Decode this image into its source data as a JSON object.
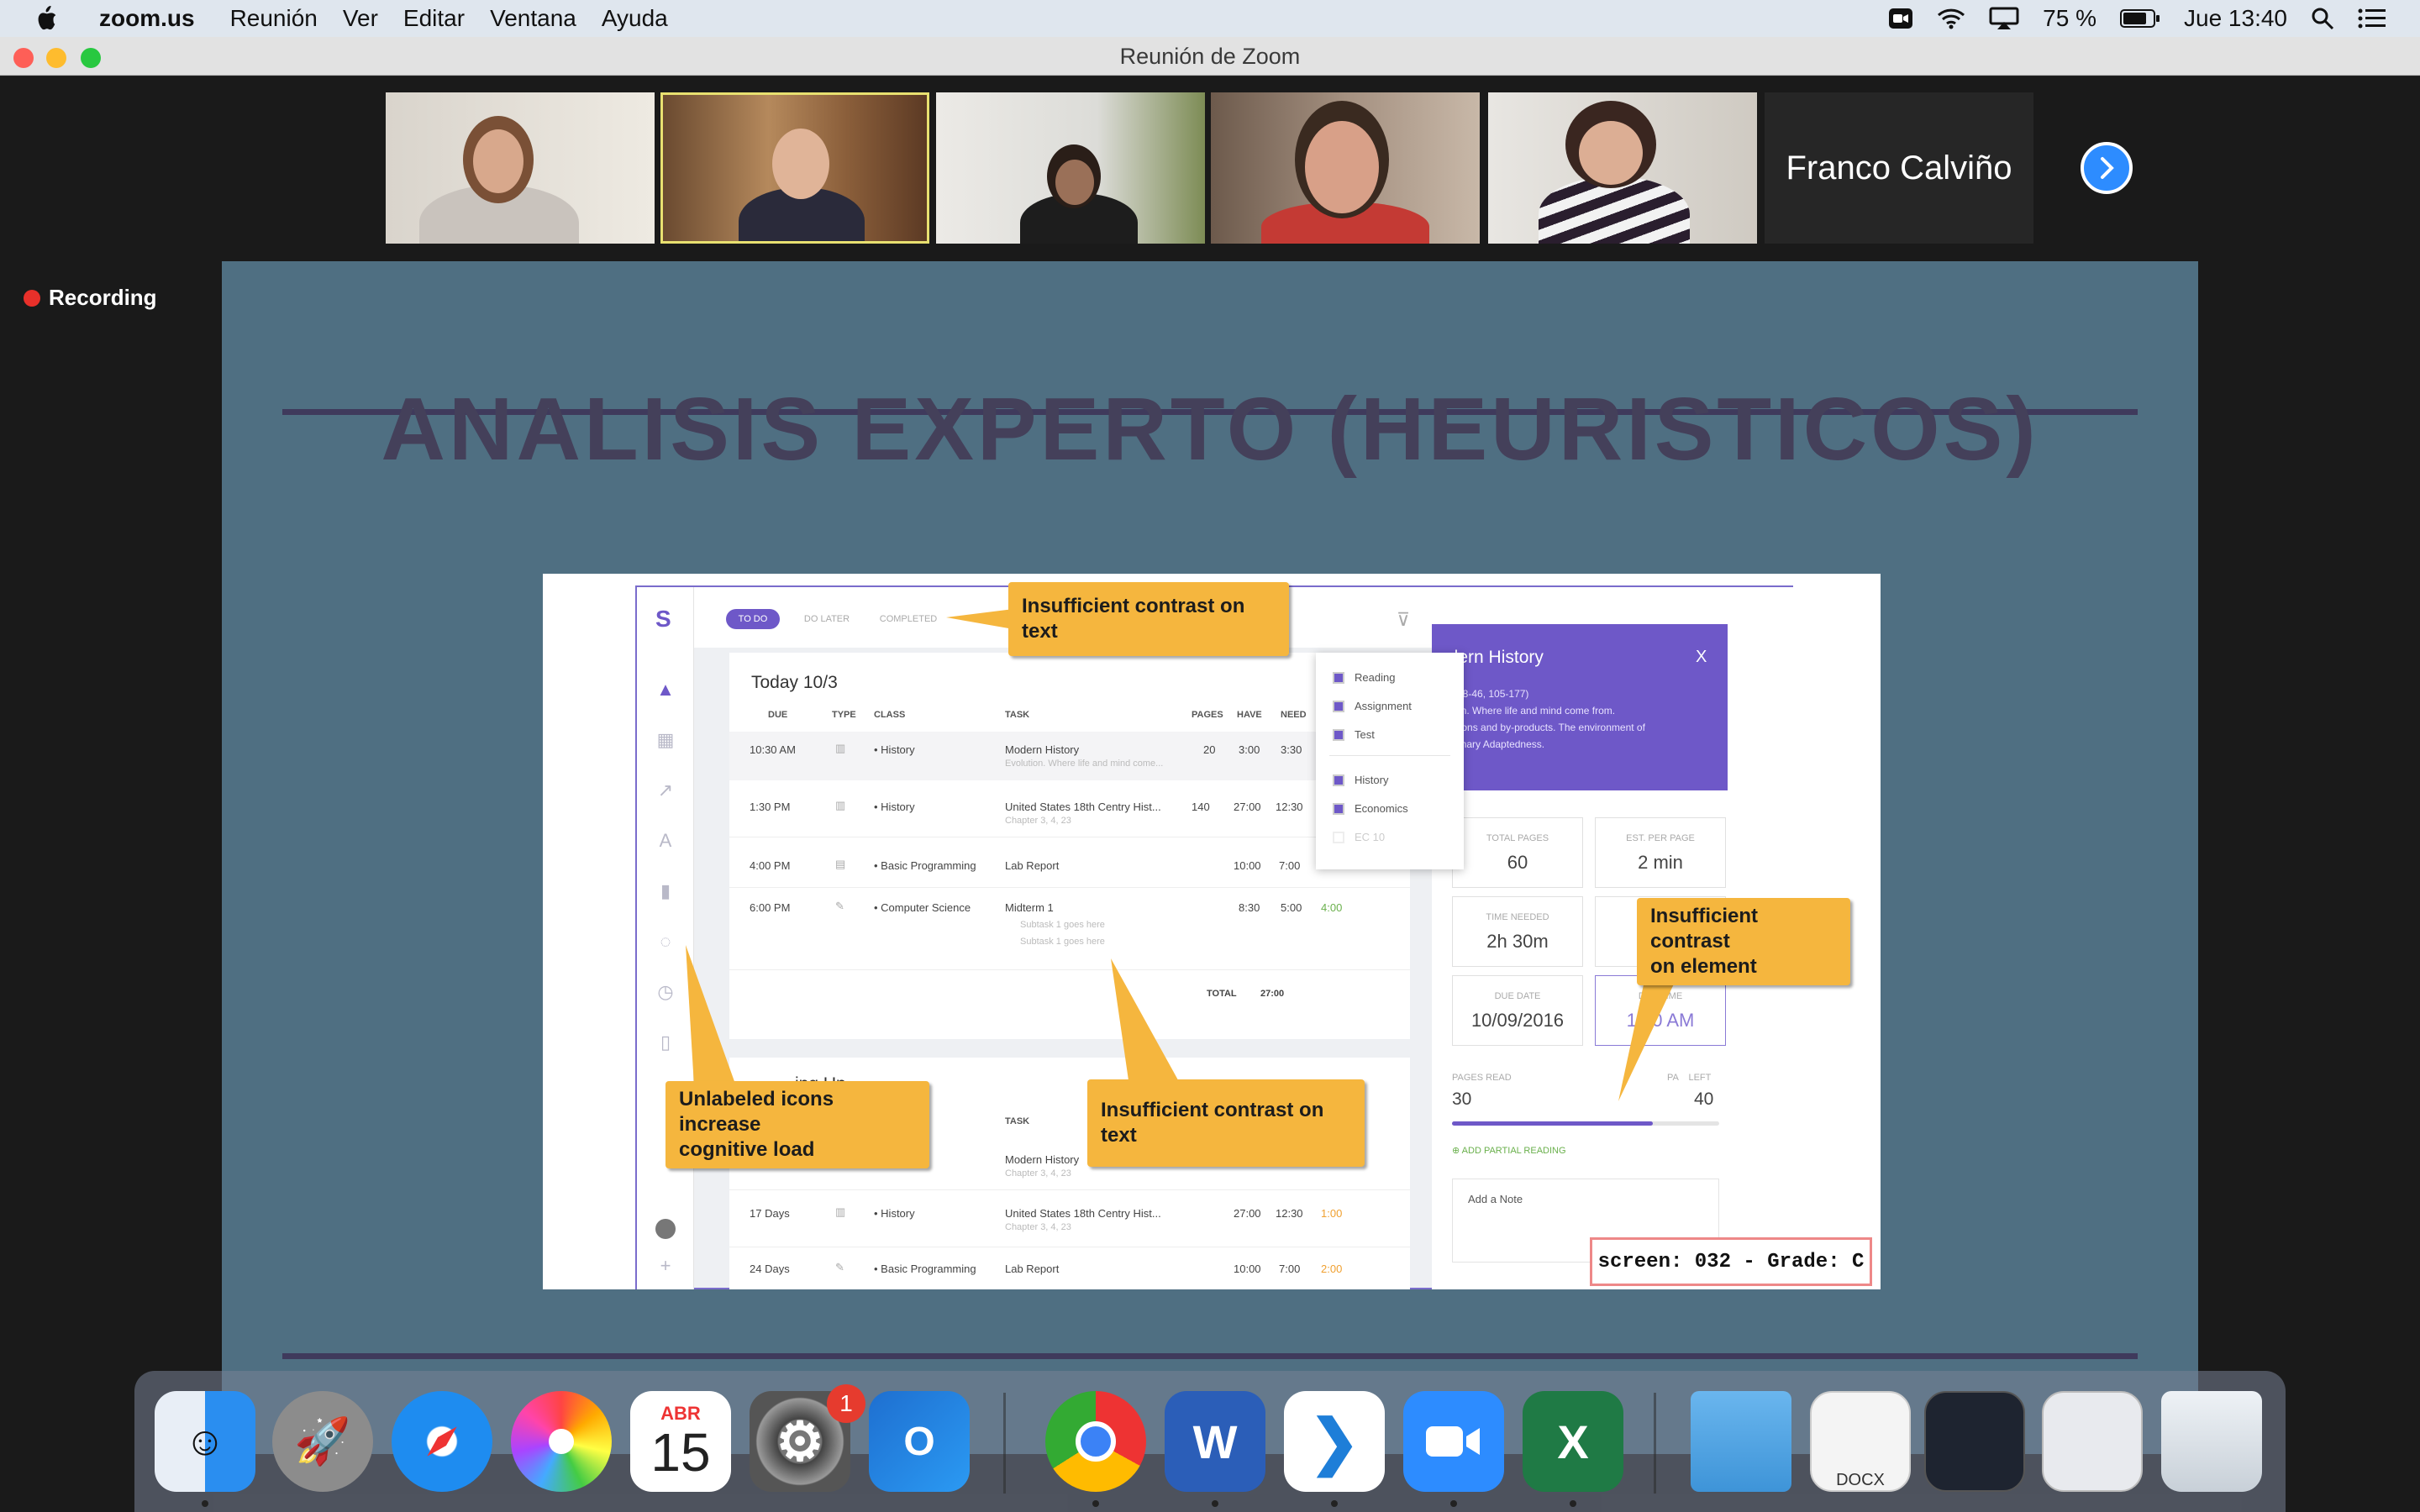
{
  "menubar": {
    "app_name": "zoom.us",
    "items": [
      "Reunión",
      "Ver",
      "Editar",
      "Ventana",
      "Ayuda"
    ],
    "battery": "75 %",
    "clock": "Jue 13:40"
  },
  "window": {
    "title": "Reunión de Zoom"
  },
  "participants": {
    "name_tile": "Franco Calviño"
  },
  "recording": {
    "label": "Recording"
  },
  "slide": {
    "title": "ANALISIS EXPERTO (HEURISTICOS)",
    "screenshot": {
      "logo": "S",
      "tabs": [
        "TO DO",
        "DO LATER",
        "COMPLETED"
      ],
      "list_title": "Today 10/3",
      "columns": [
        "DUE",
        "TYPE",
        "CLASS",
        "TASK",
        "PAGES",
        "HAVE",
        "NEED"
      ],
      "rows": [
        {
          "due": "10:30 AM",
          "class": "History",
          "task": "Modern History",
          "sub": "Evolution. Where life and mind come...",
          "pages": "20",
          "have": "3:00",
          "need": "3:30"
        },
        {
          "due": "1:30 PM",
          "class": "History",
          "task": "United States 18th Centry Hist...",
          "sub": "Chapter 3, 4, 23",
          "pages": "140",
          "have": "27:00",
          "need": "12:30"
        },
        {
          "due": "4:00 PM",
          "class": "Basic Programming",
          "task": "Lab Report",
          "sub": "",
          "pages": "",
          "have": "10:00",
          "need": "7:00",
          "extra": "2:00"
        },
        {
          "due": "6:00 PM",
          "class": "Computer Science",
          "task": "Midterm 1",
          "sub": "Subtask 1 goes here",
          "sub2": "Subtask 1 goes here",
          "pages": "",
          "have": "8:30",
          "need": "5:00",
          "extra": "4:00"
        }
      ],
      "total_label": "TOTAL",
      "total_value": "27:00",
      "upcoming_title": "ing Up",
      "upcoming_task_header": "TASK",
      "upcoming_rows": [
        {
          "due": "",
          "class": "",
          "task": "Modern History",
          "sub": "Chapter 3, 4, 23",
          "have": "",
          "need": "",
          "extra": ""
        },
        {
          "due": "17 Days",
          "class": "History",
          "task": "United States 18th Centry Hist...",
          "sub": "Chapter 3, 4, 23",
          "have": "27:00",
          "need": "12:30",
          "extra": "1:00"
        },
        {
          "due": "24 Days",
          "class": "Basic Programming",
          "task": "Lab Report",
          "sub": "",
          "have": "10:00",
          "need": "7:00",
          "extra": "2:00"
        }
      ],
      "dropdown": [
        "Reading",
        "Assignment",
        "Test",
        "History",
        "Economics",
        "EC 10"
      ],
      "panel": {
        "title": "odern History",
        "close": "X",
        "desc1": "-25, 38-46, 105-177)",
        "desc2": "olution. Where life and mind come from.",
        "desc3": "aptations and by-products. The environment of",
        "desc4": "olutionary Adaptedness.",
        "total_pages_label": "TOTAL PAGES",
        "total_pages": "60",
        "est_label": "EST. PER PAGE",
        "est": "2 min",
        "time_needed_label": "TIME NEEDED",
        "time_needed": "2h 30m",
        "time_cut_label": "TI",
        "due_date_label": "DUE DATE",
        "due_date": "10/09/2016",
        "due_time_label": "DUE TIME",
        "due_time": "10:0 AM",
        "pages_read_label": "PAGES READ",
        "pages_read": "30",
        "pages_left_label": "PA    LEFT",
        "pages_left": "40",
        "progress": 0.75,
        "add_partial": "ADD PARTIAL READING",
        "note_placeholder": "Add a Note"
      }
    },
    "callouts": {
      "c1": "Insufficient contrast on text",
      "c2a": "Insufficient contrast",
      "c2b": "on element",
      "c3a": "Unlabeled icons increase",
      "c3b": "cognitive load",
      "c4": "Insufficient contrast on text"
    },
    "grade": "screen: 032 - Grade: C"
  },
  "dock": {
    "calendar_month": "ABR",
    "calendar_day": "15",
    "prefs_badge": "1",
    "docx_label": "DOCX"
  },
  "colors": {
    "accent": "#6e58c8",
    "callout": "#f5b63e",
    "zoom_blue": "#2d8cff"
  }
}
